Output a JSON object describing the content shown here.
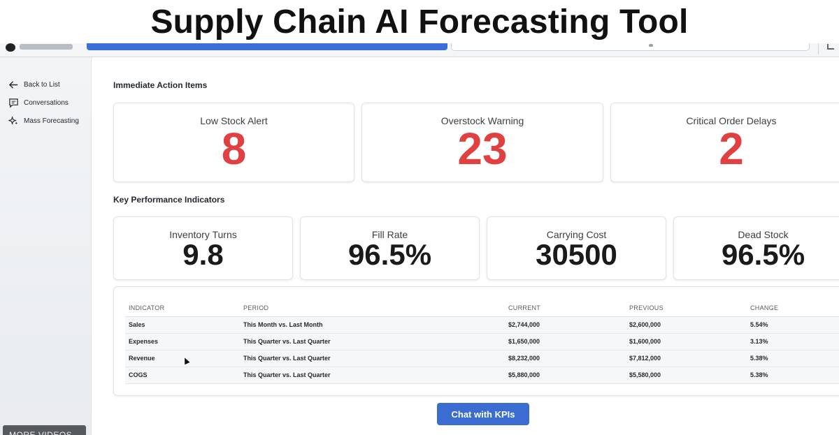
{
  "banner": {
    "title": "Supply Chain AI Forecasting Tool"
  },
  "sidebar": {
    "items": [
      {
        "label": "Back to List",
        "icon": "arrow-left-icon"
      },
      {
        "label": "Conversations",
        "icon": "chat-bubble-icon"
      },
      {
        "label": "Mass Forecasting",
        "icon": "sparkles-icon"
      }
    ],
    "overlay_label": "MORE VIDEOS"
  },
  "immediate_actions": {
    "title": "Immediate Action Items",
    "cards": [
      {
        "label": "Low Stock Alert",
        "value": "8"
      },
      {
        "label": "Overstock Warning",
        "value": "23"
      },
      {
        "label": "Critical Order Delays",
        "value": "2"
      }
    ],
    "value_color": "#e04040"
  },
  "kpis": {
    "title": "Key Performance Indicators",
    "cards": [
      {
        "label": "Inventory Turns",
        "value": "9.8"
      },
      {
        "label": "Fill Rate",
        "value": "96.5%"
      },
      {
        "label": "Carrying Cost",
        "value": "30500"
      },
      {
        "label": "Dead Stock",
        "value": "96.5%"
      }
    ]
  },
  "table": {
    "headers": [
      "INDICATOR",
      "PERIOD",
      "CURRENT",
      "PREVIOUS",
      "CHANGE"
    ],
    "rows": [
      [
        "Sales",
        "This Month vs. Last Month",
        "$2,744,000",
        "$2,600,000",
        "5.54%"
      ],
      [
        "Expenses",
        "This Quarter vs. Last Quarter",
        "$1,650,000",
        "$1,600,000",
        "3.13%"
      ],
      [
        "Revenue",
        "This Quarter vs. Last Quarter",
        "$8,232,000",
        "$7,812,000",
        "5.38%"
      ],
      [
        "COGS",
        "This Quarter vs. Last Quarter",
        "$5,880,000",
        "$5,580,000",
        "5.38%"
      ]
    ]
  },
  "chat_button": {
    "label": "Chat with KPIs"
  },
  "colors": {
    "accent": "#3a6cd1",
    "alert": "#e04040"
  }
}
